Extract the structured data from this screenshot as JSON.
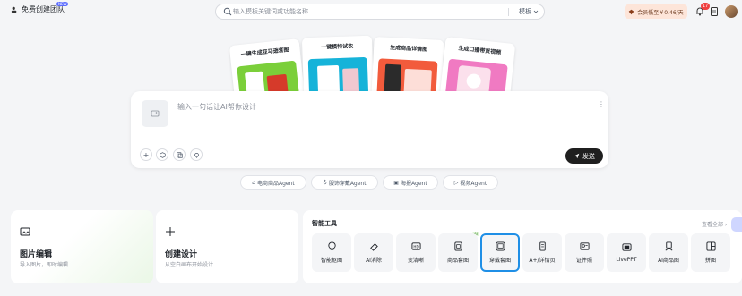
{
  "header": {
    "brand_label": "免费创建团队",
    "new_badge": "NEW",
    "search_placeholder": "输入模板关键词或功能名称",
    "search_scope": "模板",
    "vip_label": "会员低至￥0.46/天",
    "notification_count": "17"
  },
  "feature_cards": [
    {
      "title": "一键生成亚马逊套图",
      "color": "#7bcf3a"
    },
    {
      "title": "一键模特试衣",
      "color": "#16b3d9"
    },
    {
      "title": "生成商品详情图",
      "color": "#f25b3c"
    },
    {
      "title": "生成口播带货视频",
      "color": "#f07ac2"
    }
  ],
  "prompt": {
    "placeholder": "输入一句话让AI帮你设计",
    "send_label": "发送"
  },
  "agents": [
    {
      "label": "电商商品Agent"
    },
    {
      "label": "服饰穿戴Agent"
    },
    {
      "label": "海报Agent"
    },
    {
      "label": "视频Agent"
    }
  ],
  "cards": {
    "edit": {
      "title": "图片编辑",
      "subtitle": "导入图片，即时编辑"
    },
    "create": {
      "title": "创建设计",
      "subtitle": "从空白画布开始设计"
    }
  },
  "tools": {
    "title": "智能工具",
    "view_all": "查看全部 ›",
    "ai_tag": "AI",
    "items": [
      {
        "label": "智能抠图",
        "icon": "cutout-icon"
      },
      {
        "label": "AI消除",
        "icon": "eraser-icon"
      },
      {
        "label": "变清晰",
        "icon": "hd-icon"
      },
      {
        "label": "商品套图",
        "icon": "product-set-icon"
      },
      {
        "label": "穿戴套图",
        "icon": "wear-set-icon"
      },
      {
        "label": "A+/详情页",
        "icon": "detail-page-icon"
      },
      {
        "label": "证件照",
        "icon": "id-photo-icon"
      },
      {
        "label": "LivePPT",
        "icon": "ppt-icon"
      },
      {
        "label": "AI商品图",
        "icon": "ai-product-icon"
      },
      {
        "label": "拼图",
        "icon": "collage-icon"
      }
    ],
    "selected_index": 4
  }
}
